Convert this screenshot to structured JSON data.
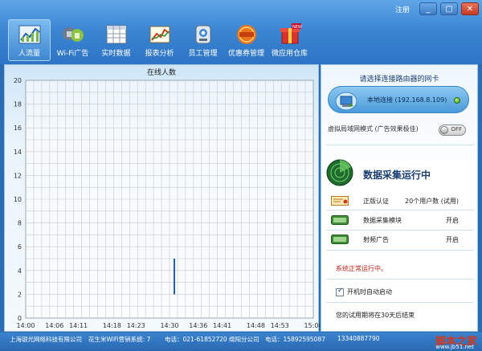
{
  "window_controls": {
    "register": "注册",
    "minimize": "_",
    "maximize": "▢",
    "close": "✕"
  },
  "tabs": [
    {
      "label": "人流量",
      "icon": "crowd-chart-icon",
      "active": true
    },
    {
      "label": "Wi-Fi广告",
      "icon": "wifi-ad-icon",
      "active": false
    },
    {
      "label": "实时数据",
      "icon": "realtime-table-icon",
      "active": false
    },
    {
      "label": "报表分析",
      "icon": "report-chart-icon",
      "active": false
    },
    {
      "label": "员工管理",
      "icon": "employee-icon",
      "active": false
    },
    {
      "label": "优惠券管理",
      "icon": "coupon-icon",
      "active": false
    },
    {
      "label": "微应用仓库",
      "icon": "app-store-icon",
      "active": false
    }
  ],
  "chart_data": {
    "type": "line",
    "title": "在线人数",
    "x": [
      "14:00",
      "14:06",
      "14:11",
      "14:18",
      "14:23",
      "14:30",
      "14:36",
      "14:41",
      "14:48",
      "14:53",
      "15:00"
    ],
    "ylim": [
      0,
      20
    ],
    "yticks": [
      0,
      2,
      4,
      6,
      8,
      10,
      12,
      14,
      16,
      18,
      20
    ],
    "grid": true,
    "series": [
      {
        "points": [
          {
            "x": "14:31",
            "y": 2
          },
          {
            "x": "14:31",
            "y": 5
          }
        ]
      }
    ],
    "color": "#1f5fb0"
  },
  "right_panel": {
    "select_nic_label": "请选择连接路由器的网卡",
    "nic_label": "本地连接 (192.168.8.109)",
    "virtual_mode_label": "虚拟局域网模式 (广告效果极佳)",
    "toggle_label": "OFF",
    "status_title": "数据采集运行中",
    "rows": [
      {
        "label": "正版认证",
        "value": "20个用户数 (试用)",
        "icon": "certificate-icon"
      },
      {
        "label": "数据采集模块",
        "value": "开启",
        "icon": "module-badge-icon"
      },
      {
        "label": "射频广告",
        "value": "开启",
        "icon": "module-badge-icon"
      }
    ],
    "system_ok": "系统正常运行中。",
    "autostart_label": "开机时自动启动",
    "trial_text": "您的试用期将在30天后结束"
  },
  "status_bar": {
    "company": "上海银光网络科技有限公司",
    "product": "花生米WiFi营销系统: 7",
    "phone": "电话：021-61852720",
    "branch": "绵阳分公司",
    "branch_phone": "电话：15892595087",
    "mobile": "13340887790",
    "watermark": "脚本之家",
    "watermark_url": "www.jb51.net"
  },
  "colors": {
    "toolbar": "#3c86d4",
    "chart_line": "#1f5fb0",
    "grid": "#c9c9c9",
    "status_red": "#b8231a"
  }
}
